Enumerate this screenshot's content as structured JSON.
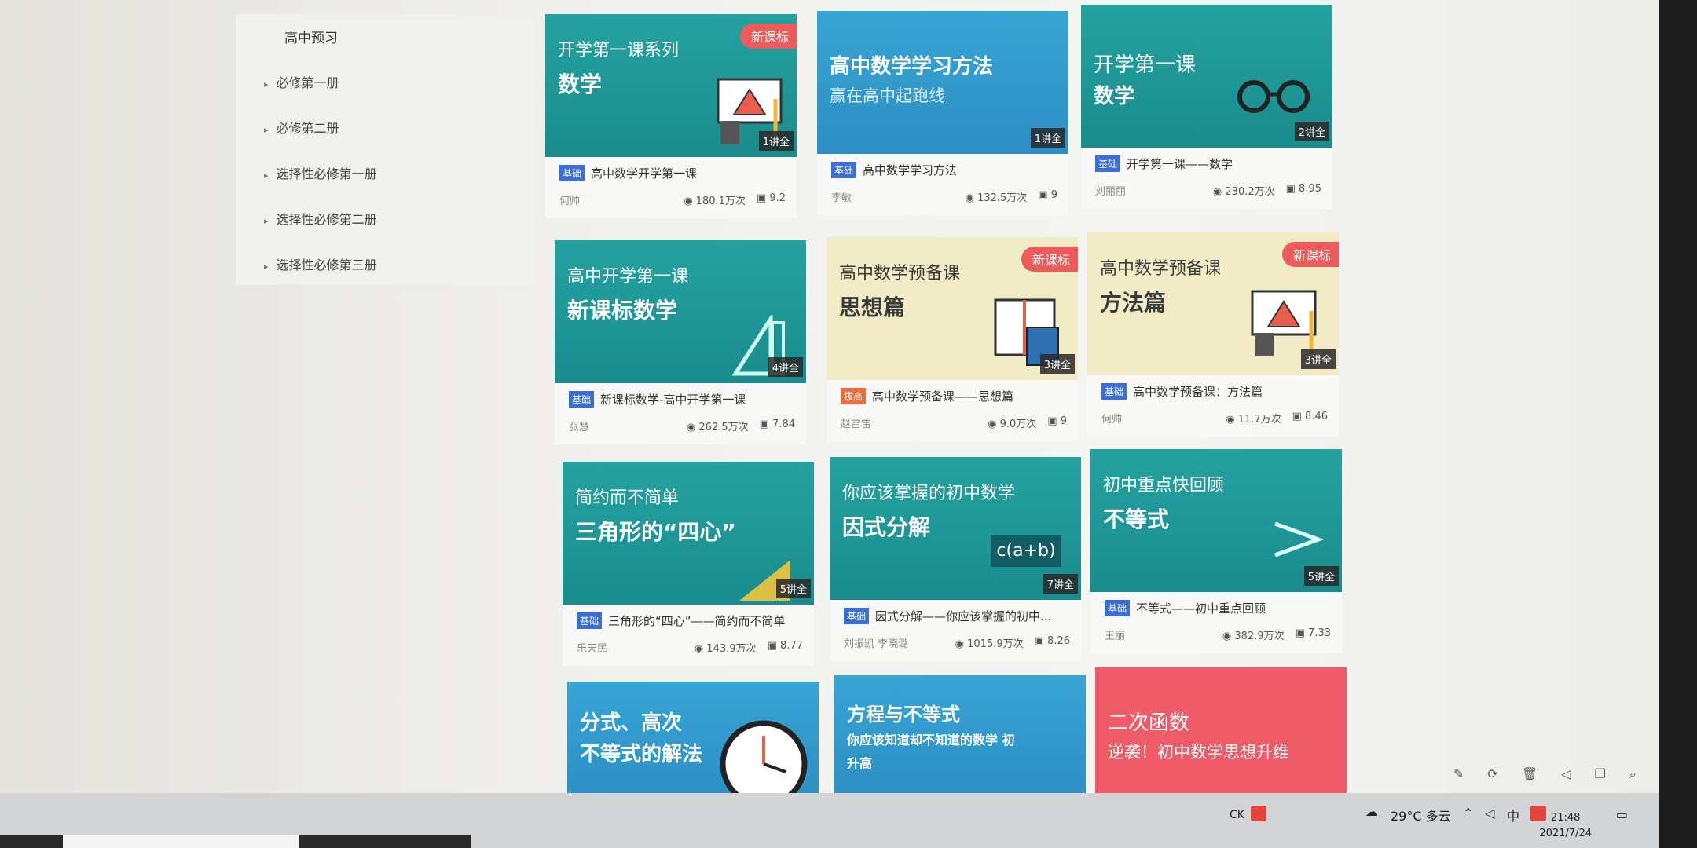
{
  "sidebar": {
    "title": "高中预习",
    "items": [
      {
        "label": "必修第一册"
      },
      {
        "label": "必修第二册"
      },
      {
        "label": "选择性必修第一册"
      },
      {
        "label": "选择性必修第二册"
      },
      {
        "label": "选择性必修第三册"
      }
    ]
  },
  "cards": [
    {
      "line1": "开学第一课系列",
      "line2": "数学",
      "tag": "新课标",
      "lessons": "1讲全",
      "badge": "基础",
      "title": "高中数学开学第一课",
      "teacher": "何帅",
      "views": "180.1万次",
      "score": "9.2"
    },
    {
      "line1": "高中数学学习方法",
      "line2": "赢在高中起跑线",
      "tag": "",
      "lessons": "1讲全",
      "badge": "基础",
      "title": "高中数学学习方法",
      "teacher": "李敏",
      "views": "132.5万次",
      "score": "9"
    },
    {
      "line1": "开学第一课",
      "line2": "数学",
      "tag": "",
      "lessons": "2讲全",
      "badge": "基础",
      "title": "开学第一课——数学",
      "teacher": "刘丽丽",
      "views": "230.2万次",
      "score": "8.95"
    },
    {
      "line1": "高中开学第一课",
      "line2": "新课标数学",
      "tag": "",
      "lessons": "4讲全",
      "badge": "基础",
      "title": "新课标数学-高中开学第一课",
      "teacher": "张慧",
      "views": "262.5万次",
      "score": "7.84"
    },
    {
      "line1": "高中数学预备课",
      "line2": "思想篇",
      "tag": "新课标",
      "lessons": "3讲全",
      "badge": "拔高",
      "title": "高中数学预备课——思想篇",
      "teacher": "赵雷雷",
      "views": "9.0万次",
      "score": "9"
    },
    {
      "line1": "高中数学预备课",
      "line2": "方法篇",
      "tag": "新课标",
      "lessons": "3讲全",
      "badge": "基础",
      "title": "高中数学预备课：方法篇",
      "teacher": "何帅",
      "views": "11.7万次",
      "score": "8.46"
    },
    {
      "line1": "简约而不简单",
      "line2": "三角形的“四心”",
      "tag": "",
      "lessons": "5讲全",
      "badge": "基础",
      "title": "三角形的“四心”——简约而不简单",
      "teacher": "乐天民",
      "views": "143.9万次",
      "score": "8.77"
    },
    {
      "line1": "你应该掌握的初中数学",
      "line2": "因式分解",
      "tag": "",
      "lessons": "7讲全",
      "badge": "基础",
      "title": "因式分解——你应该掌握的初中...",
      "teacher": "刘振凯 李晓璐",
      "views": "1015.9万次",
      "score": "8.26"
    },
    {
      "line1": "初中重点快回顾",
      "line2": "不等式",
      "tag": "",
      "lessons": "5讲全",
      "badge": "基础",
      "title": "不等式——初中重点回顾",
      "teacher": "王丽",
      "views": "382.9万次",
      "score": "7.33"
    },
    {
      "line1": "分式、高次",
      "line2": "不等式的解法",
      "tag": "",
      "lessons": "",
      "badge": "",
      "title": "",
      "teacher": "",
      "views": "",
      "score": ""
    },
    {
      "line1": "方程与不等式",
      "line2": "你应该知道却不知道的数学 初升高",
      "tag": "",
      "lessons": "",
      "badge": "",
      "title": "",
      "teacher": "",
      "views": "",
      "score": ""
    },
    {
      "line1": "二次函数",
      "line2": "逆袭！初中数学思想升维",
      "tag": "",
      "lessons": "",
      "badge": "",
      "title": "",
      "teacher": "",
      "views": "",
      "score": ""
    }
  ],
  "formula": "c(a+b)",
  "taskbar": {
    "weather": "29°C 多云",
    "ime_lang": "中",
    "ck": "CK",
    "time": "21:48",
    "date": "2021/7/24"
  },
  "colors": {
    "teal": "#1a8c8e",
    "blue": "#2d8fc5",
    "cream": "#f1ecc6",
    "red": "#ef5b66",
    "badge_blue": "#3a6fd8",
    "badge_orange": "#ef6c3c",
    "new_tag": "#ee5b5b"
  }
}
